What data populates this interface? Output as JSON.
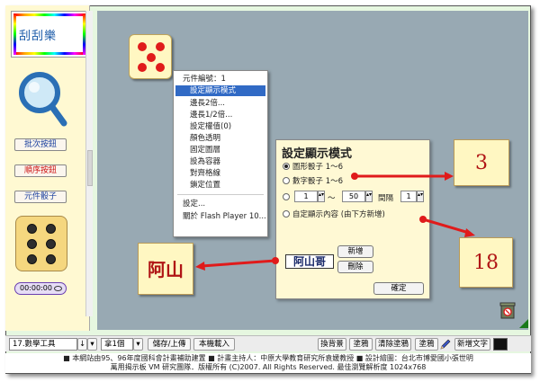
{
  "logo_text": "刮刮樂",
  "sidebar": {
    "btn_batch": "批次按鈕",
    "btn_order": "順序按鈕",
    "btn_dice": "元件骰子",
    "timer": "00:00:00"
  },
  "context_menu": {
    "header": "元件編號：1",
    "items": [
      "設定顯示模式",
      "邊長2倍...",
      "邊長1/2倍...",
      "設定權值(0)",
      "顏色透明",
      "固定圖層",
      "設為容器",
      "對齊格線",
      "鎖定位置"
    ],
    "settings": "設定...",
    "about": "關於 Flash Player 10..."
  },
  "dialog": {
    "title": "設定顯示模式",
    "opt_shape": "圖形骰子 1～6",
    "opt_number": "數字骰子 1～6",
    "range_from": "1",
    "range_tilde": "～",
    "range_to": "50",
    "interval_label": "間隔",
    "interval_value": "1",
    "opt_custom": "自定顯示內容 (由下方新增)",
    "custom_preview": "阿山哥",
    "btn_add": "新增",
    "btn_delete": "刪除",
    "btn_ok": "確定"
  },
  "cards": {
    "card_3": "3",
    "card_18": "18",
    "card_ashan": "阿山"
  },
  "toolbar": {
    "tool_select": "17.數學工具",
    "count_select": "拿1個",
    "btn_save": "儲存/上傳",
    "btn_load": "本機載入",
    "btn_bg": "換背景",
    "btn_paint": "塗鴉",
    "btn_clear": "清除塗鴉",
    "btn_eraser": "塗鴉",
    "btn_text": "新增文字"
  },
  "footer": {
    "line1": "■ 本網站由95、96年度國科會計畫補助建置  ■ 計畫主持人：中原大學教育研究所袁媛教授  ■ 設計繪圖：台北市博愛國小張世明",
    "line2": "萬用揭示板 VM 研究團隊．版權所有 (C)2007. All Rights Reserved. 最佳瀏覽解析度 1024x768"
  },
  "colors": {
    "canvas_bg": "#98a9b3",
    "sidebar_bg": "#fff9d2",
    "accent_red": "#e01b1b",
    "menu_highlight": "#316ac5"
  }
}
